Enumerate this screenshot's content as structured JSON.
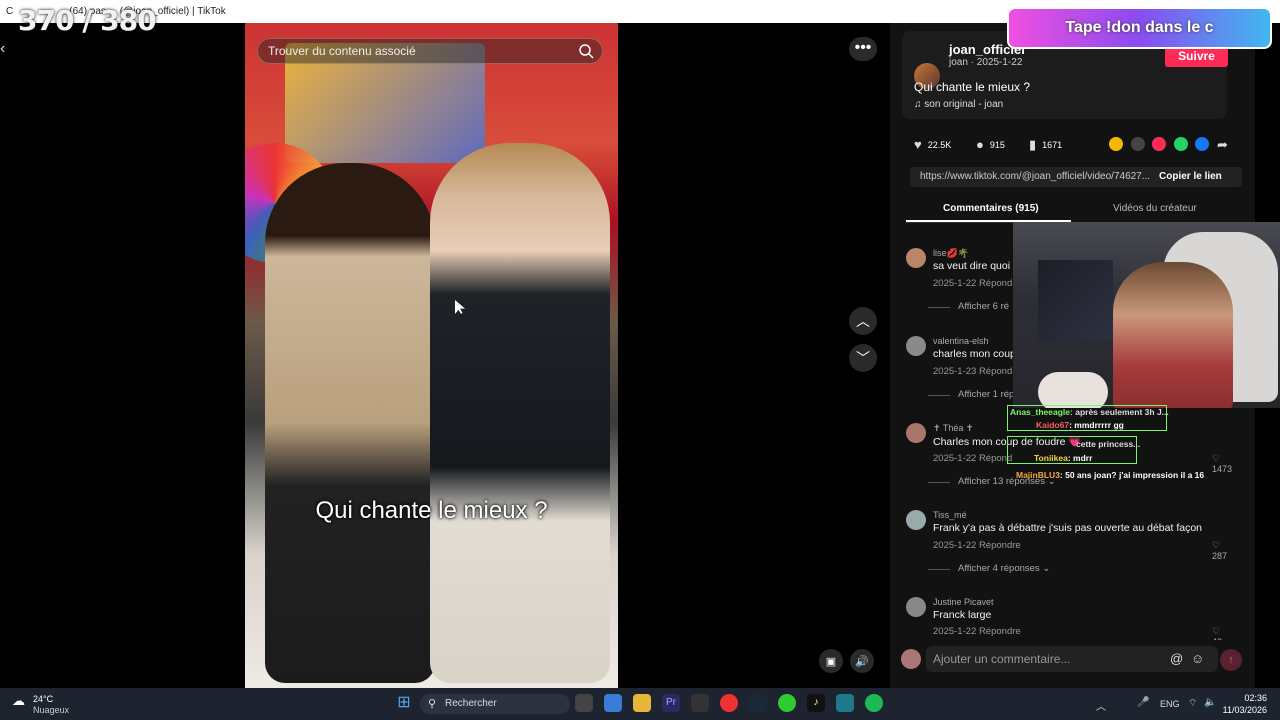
{
  "browser": {
    "tab_title": "(64) pas ... (@joan_officiel) | TikTok",
    "nav_glyph": "C"
  },
  "overlay": {
    "counter": "370 / 380",
    "donate_banner": "Tape !don dans le c"
  },
  "video": {
    "search_placeholder": "Trouver du contenu associé",
    "caption": "Qui chante le mieux ?"
  },
  "post": {
    "username": "joan_officiel",
    "meta": "joan · 2025-1-22",
    "follow_label": "Suivre",
    "description": "Qui chante le mieux ?",
    "music": "son original - joan",
    "likes": "22.5K",
    "comments": "915",
    "saves": "1671",
    "link": "https://www.tiktok.com/@joan_officiel/video/74627...",
    "copy_label": "Copier le lien",
    "share_colors": [
      "#f5b800",
      "#444444",
      "#fe2c55",
      "#25d366",
      "#1877f2"
    ]
  },
  "tabs": {
    "comments": "Commentaires (915)",
    "creator_videos": "Vidéos du créateur"
  },
  "comments": [
    {
      "name": "lise💋🌴",
      "text": "sa veut dire quoi p",
      "meta": "2025-1-22   Répond",
      "replies": "Afficher 6 ré",
      "likes": ""
    },
    {
      "name": "valentina-elsh",
      "text": "charles mon coup",
      "meta": "2025-1-23   Répond",
      "replies": "Afficher 1 répo",
      "likes": ""
    },
    {
      "name": "✝ Théa ✝",
      "text": "Charles mon coup de foudre 💗",
      "meta": "2025-1-22   Répond",
      "replies": "Afficher 13 réponses ⌄",
      "likes": "♡ 1473"
    },
    {
      "name": "Tiss_mé",
      "text": "Frank y'a pas à débattre j'suis pas ouverte au débat façon",
      "meta": "2025-1-22   Répondre",
      "replies": "Afficher 4 réponses ⌄",
      "likes": "♡ 287"
    },
    {
      "name": "Justine Picavet",
      "text": "Franck large",
      "meta": "2025-1-22   Répondre",
      "replies": "",
      "likes": "♡ 42"
    }
  ],
  "comment_input_placeholder": "Ajouter un commentaire...",
  "chat": [
    {
      "user": "Anas_theeagle:",
      "msg": "après seulement 3h J..."
    },
    {
      "user": "Kaido67",
      "msg": ": mmdrrrrr gg"
    },
    {
      "user": "",
      "msg": "cette princess..."
    },
    {
      "user": "Toniikea",
      "msg": ": mdrr"
    },
    {
      "user": "MajinBLU3",
      "msg": ": 50 ans joan? j'ai impression il a 16"
    }
  ],
  "taskbar": {
    "weather_temp": "24°C",
    "weather_desc": "Nuageux",
    "search_label": "Rechercher",
    "lang": "ENG",
    "time": "02:36",
    "date": "11/03/2026"
  }
}
